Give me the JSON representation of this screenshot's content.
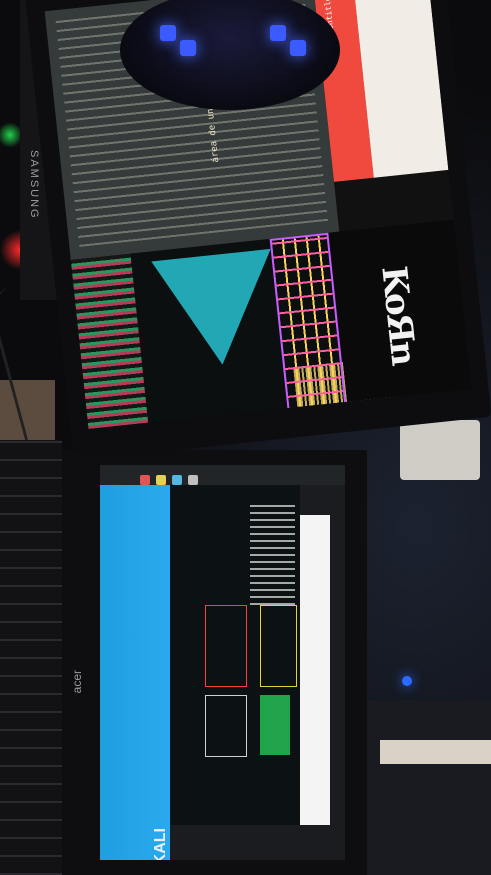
{
  "scene": {
    "description_labels": {
      "samsung": "SAMSUNG",
      "korn": "KoЯn",
      "kali": "KALI",
      "acer": "acer"
    },
    "colors": {
      "laptop_blue": "#2aa9ee",
      "code_bg": "#353b3a",
      "red_panel": "#f04a3e",
      "cyan_triangle": "#27c3d2",
      "headphone_led": "#3b5bff"
    },
    "code_snippet": "área de un triangulo",
    "red_panel_title": "Test Untitled"
  },
  "icons": [
    "red-app-icon",
    "yellow-app-icon",
    "blue-app-icon",
    "gray-app-icon"
  ]
}
